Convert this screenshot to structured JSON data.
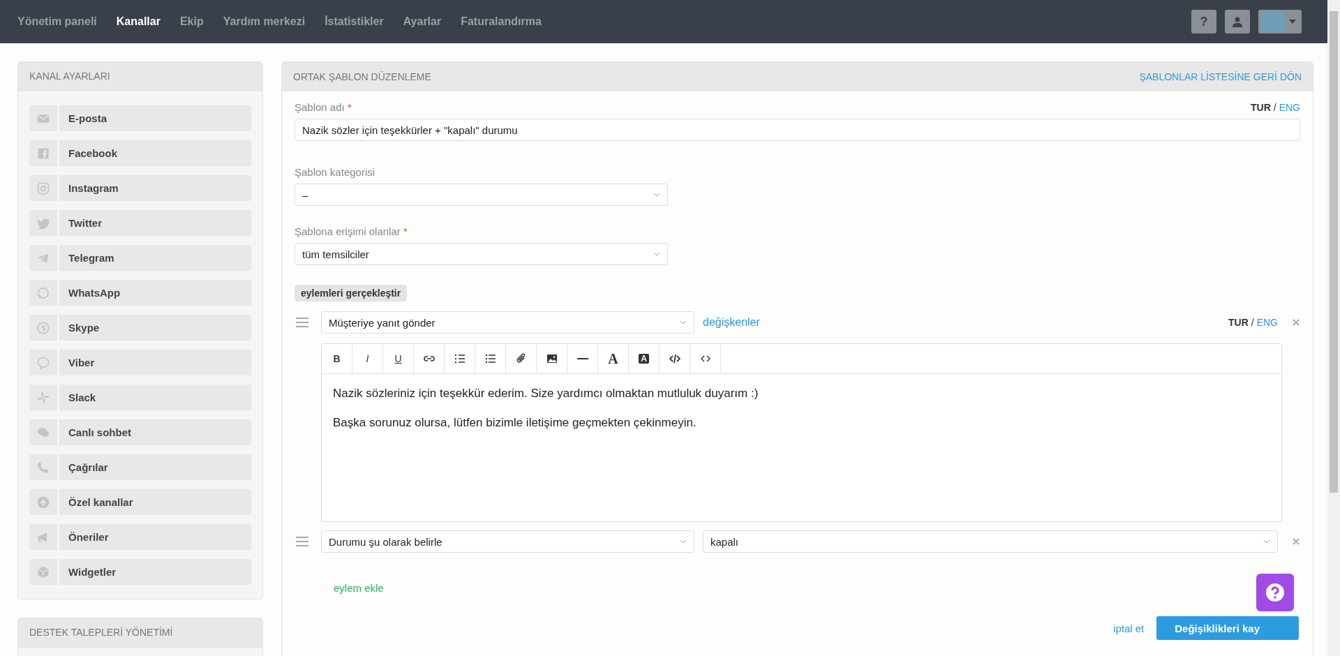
{
  "nav": {
    "items": [
      {
        "label": "Yönetim paneli",
        "selected": false
      },
      {
        "label": "Kanallar",
        "selected": true
      },
      {
        "label": "Ekip",
        "selected": false
      },
      {
        "label": "Yardım merkezi",
        "selected": false
      },
      {
        "label": "İstatistikler",
        "selected": false
      },
      {
        "label": "Ayarlar",
        "selected": false
      },
      {
        "label": "Faturalandırma",
        "selected": false
      }
    ],
    "help_label": "?"
  },
  "sidebar": {
    "panels": [
      {
        "title": "KANAL AYARLARI",
        "items": [
          {
            "label": "E-posta",
            "kind": "email"
          },
          {
            "label": "Facebook",
            "kind": "facebook"
          },
          {
            "label": "Instagram",
            "kind": "instagram"
          },
          {
            "label": "Twitter",
            "kind": "twitter"
          },
          {
            "label": "Telegram",
            "kind": "telegram"
          },
          {
            "label": "WhatsApp",
            "kind": "whatsapp"
          },
          {
            "label": "Skype",
            "kind": "skype"
          },
          {
            "label": "Viber",
            "kind": "viber"
          },
          {
            "label": "Slack",
            "kind": "slack"
          },
          {
            "label": "Canlı sohbet",
            "kind": "chat"
          },
          {
            "label": "Çağrılar",
            "kind": "phone"
          },
          {
            "label": "Özel kanallar",
            "kind": "plus"
          },
          {
            "label": "Öneriler",
            "kind": "megaphone"
          },
          {
            "label": "Widgetler",
            "kind": "box"
          }
        ]
      },
      {
        "title": "DESTEK TALEPLERİ YÖNETİMİ"
      }
    ]
  },
  "editor": {
    "title": "ORTAK ŞABLON DÜZENLEME",
    "back_link": "ŞABLONLAR LİSTESİNE GERİ DÖN",
    "name_field": {
      "label": "Şablon adı",
      "required_mark": "*",
      "value": "Nazik sözler için teşekkürler + \"kapalı\" durumu",
      "languages": [
        {
          "label": "TUR",
          "selected": true
        },
        {
          "label": "ENG",
          "selected": false
        }
      ],
      "separator": "/"
    },
    "category_field": {
      "label": "Şablon kategorisi",
      "value": "–"
    },
    "access_field": {
      "label": "Şablona erişimi olanlar",
      "required_mark": "*",
      "value": "tüm temsilciler"
    },
    "actions_badge": "eylemleri gerçekleştir",
    "actions": [
      {
        "kind": "reply",
        "value": "Müşteriye yanıt gönder",
        "variables_link": "değişkenler",
        "languages": [
          {
            "label": "TUR",
            "selected": true
          },
          {
            "label": "ENG",
            "selected": false
          }
        ],
        "separator": "/",
        "toolbar": [
          {
            "kind": "bold",
            "label": "B"
          },
          {
            "kind": "italic",
            "label": "I"
          },
          {
            "kind": "underline",
            "label": "U"
          },
          {
            "kind": "link"
          },
          {
            "kind": "ordered-list"
          },
          {
            "kind": "bullet-list"
          },
          {
            "kind": "attachment"
          },
          {
            "kind": "image"
          },
          {
            "kind": "rule"
          },
          {
            "kind": "font",
            "label": "A"
          },
          {
            "kind": "highlight",
            "label": "A"
          },
          {
            "kind": "code"
          },
          {
            "kind": "source"
          }
        ],
        "paragraphs": [
          "Nazik sözleriniz için teşekkür ederim. Size yardımcı olmaktan mutluluk duyarım :)",
          "Başka sorunuz olursa, lütfen bizimle iletişime geçmekten çekinmeyin."
        ]
      },
      {
        "kind": "status",
        "value": "Durumu şu olarak belirle",
        "status": "kapalı"
      }
    ],
    "add_action": "eylem ekle",
    "cancel": "iptal et",
    "save": "Değişiklikleri kay"
  }
}
